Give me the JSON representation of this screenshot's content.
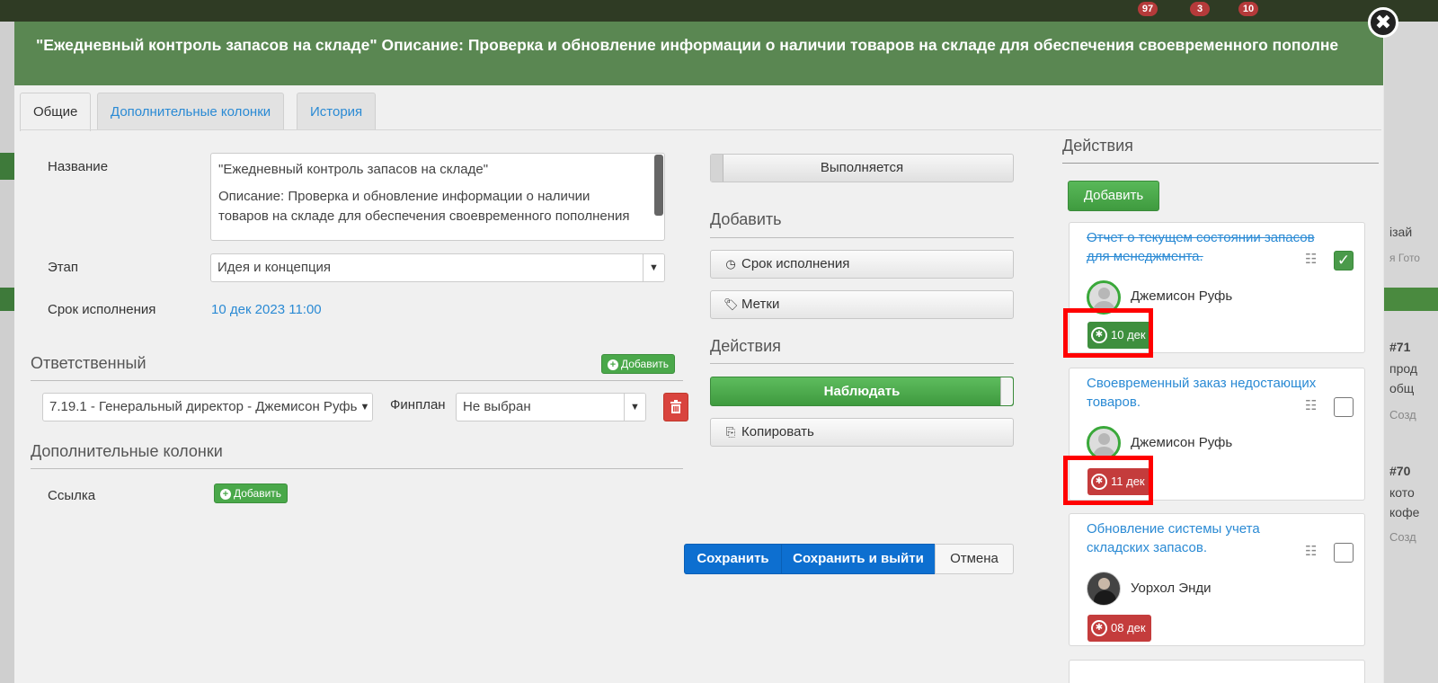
{
  "background": {
    "badges": [
      "97",
      "3",
      "10"
    ],
    "right_texts": [
      "ізай",
      "я Гото",
      "#71",
      "прод",
      "общ",
      "Созд",
      "#70",
      "кото",
      "кофе",
      "Созд"
    ]
  },
  "modal": {
    "title": "\"Ежедневный контроль запасов на складе\" Описание: Проверка и обновление информации о наличии товаров на складе для обеспечения своевременного пополне",
    "close_icon": "✖",
    "tabs": [
      "Общие",
      "Дополнительные колонки",
      "История"
    ]
  },
  "form": {
    "name_label": "Название",
    "name_value_line1": "\"Ежедневный контроль запасов на складе\"",
    "name_value_line2": "Описание: Проверка и обновление информации о наличии",
    "name_value_line3": "товаров на складе для обеспечения своевременного пополнения",
    "stage_label": "Этап",
    "stage_value": "Идея и концепция",
    "due_label": "Срок исполнения",
    "due_value": "10 дек 2023 11:00",
    "responsible_title": "Ответственный",
    "add_label": "Добавить",
    "responsible_value": "7.19.1 - Генеральный директор - Джемисон Руфь",
    "finplan_label": "Финплан",
    "finplan_value": "Не выбран",
    "extra_columns_title": "Дополнительные колонки",
    "link_label": "Ссылка"
  },
  "middle": {
    "status": "Выполняется",
    "add_title": "Добавить",
    "due_button": "Срок исполнения",
    "tags_button": "Метки",
    "actions_title": "Действия",
    "watch_button": "Наблюдать",
    "copy_button": "Копировать"
  },
  "footer": {
    "save": "Сохранить",
    "save_exit": "Сохранить и выйти",
    "cancel": "Отмена"
  },
  "actions": {
    "title": "Действия",
    "add_button": "Добавить",
    "items": [
      {
        "title": "Отчет о текущем состоянии запасов для менеджмента.",
        "done": true,
        "user": "Джемисон Руфь",
        "due": "10 дек",
        "due_color": "#3e8f3e",
        "highlighted": true
      },
      {
        "title": "Своевременный заказ недостающих товаров.",
        "done": false,
        "user": "Джемисон Руфь",
        "due": "11 дек",
        "due_color": "#c43c3c",
        "highlighted": true
      },
      {
        "title": "Обновление системы учета складских запасов.",
        "done": false,
        "user": "Уорхол Энди",
        "due": "08 дек",
        "due_color": "#c43c3c",
        "highlighted": false
      }
    ]
  },
  "colors": {
    "header_green": "#5a8752",
    "link_blue": "#2a8ad4",
    "primary_blue": "#0d6fd0",
    "highlight_red": "#ff0000"
  }
}
